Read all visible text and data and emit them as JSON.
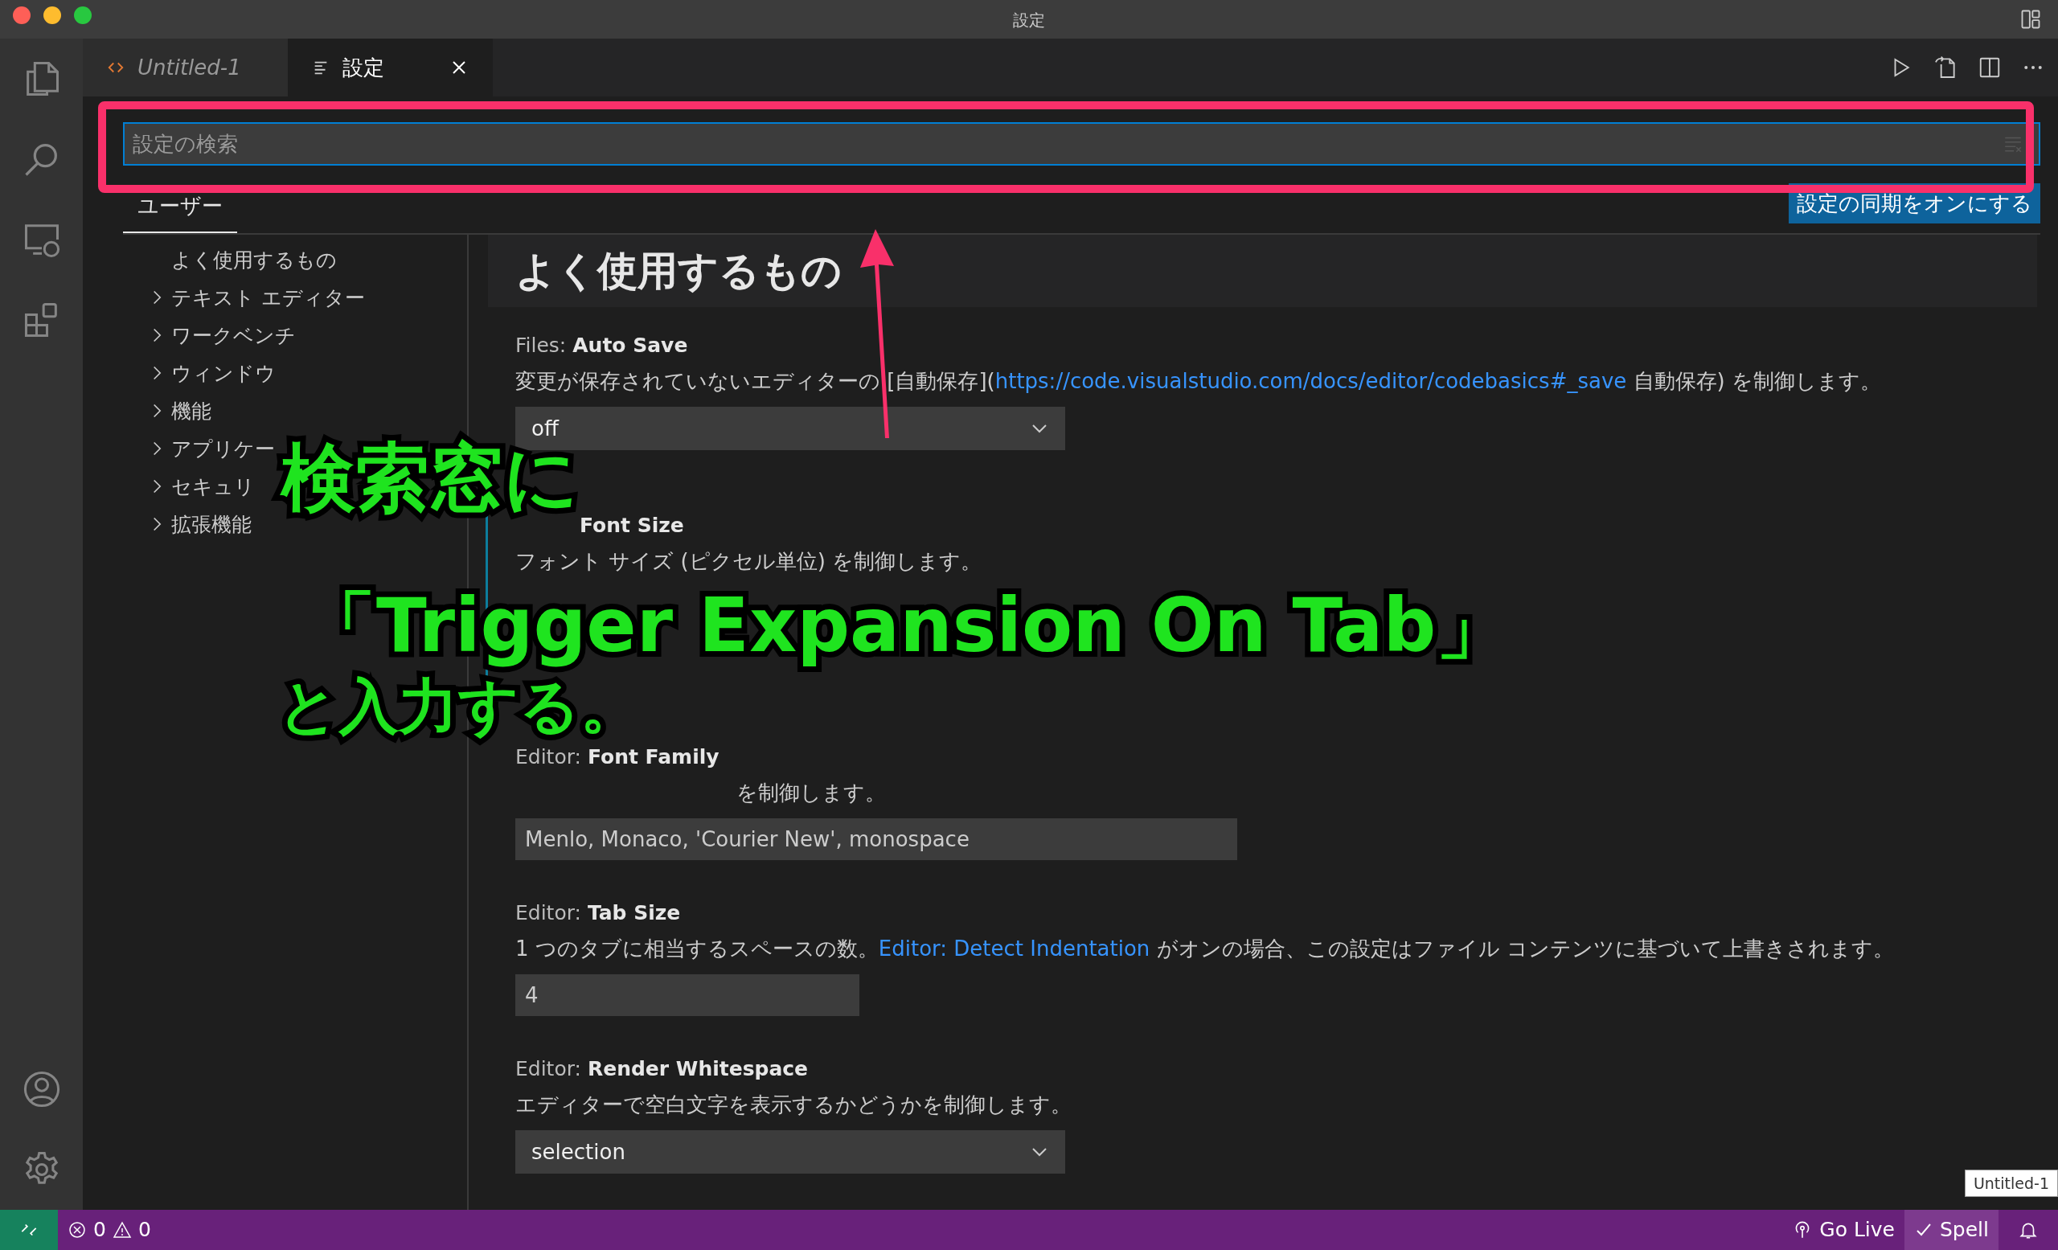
{
  "window": {
    "title": "設定"
  },
  "tabs": [
    {
      "label": "Untitled-1",
      "selected": false,
      "kind": "code"
    },
    {
      "label": "設定",
      "selected": true,
      "kind": "settings"
    }
  ],
  "search": {
    "placeholder": "設定の検索"
  },
  "scope_tabs": [
    {
      "label": "ユーザー",
      "selected": true
    }
  ],
  "sync_button": "設定の同期をオンにする",
  "toc": [
    {
      "label": "よく使用するもの",
      "expandable": false
    },
    {
      "label": "テキスト エディター",
      "expandable": true
    },
    {
      "label": "ワークベンチ",
      "expandable": true
    },
    {
      "label": "ウィンドウ",
      "expandable": true
    },
    {
      "label": "機能",
      "expandable": true
    },
    {
      "label": "アプリケー",
      "expandable": true
    },
    {
      "label": "セキュリ",
      "expandable": true
    },
    {
      "label": "拡張機能",
      "expandable": true
    }
  ],
  "section_title": "よく使用するもの",
  "settings": [
    {
      "label": "Files: **Auto Save**",
      "modified": false,
      "kind": "dropdown",
      "value": "off",
      "description": [
        {
          "text": "変更が保存されていないエディターの [自動保存]("
        },
        {
          "text": "https://code.visualstudio.com/docs/editor/codebasics#_save",
          "link": true
        },
        {
          "text": " 自動保存) を制御します。"
        }
      ]
    },
    {
      "label": "**Font Size**",
      "modified": true,
      "kind": "covered",
      "description": [
        {
          "text": "フォント サイズ (ピクセル単位) を制御します。"
        }
      ]
    },
    {
      "label": "Editor: **Font Family**",
      "modified": false,
      "kind": "text",
      "value": "Menlo, Monaco, 'Courier New', monospace",
      "description": [
        {
          "text": "を制御します。"
        }
      ]
    },
    {
      "label": "Editor: **Tab Size**",
      "modified": false,
      "kind": "number",
      "value": "4",
      "description": [
        {
          "text": "1 つのタブに相当するスペースの数。"
        },
        {
          "text": "Editor: Detect Indentation",
          "link": true
        },
        {
          "text": " がオンの場合、この設定はファイル コンテンツに基づいて上書きされます。"
        }
      ]
    },
    {
      "label": "Editor: **Render Whitespace**",
      "modified": false,
      "kind": "dropdown",
      "value": "selection",
      "description": [
        {
          "text": "エディターで空白文字を表示するかどうかを制御します。"
        }
      ]
    }
  ],
  "hover_label": "Untitled-1",
  "status_bar": {
    "errors": "0",
    "warnings": "0",
    "items": [
      {
        "label": "Go Live",
        "kind": "broadcast",
        "active": false
      },
      {
        "label": "Spell",
        "kind": "check",
        "active": true
      }
    ]
  },
  "annotation": {
    "lines": [
      "検索窓に",
      "「Trigger Expansion On Tab」",
      "と入力する。"
    ]
  }
}
